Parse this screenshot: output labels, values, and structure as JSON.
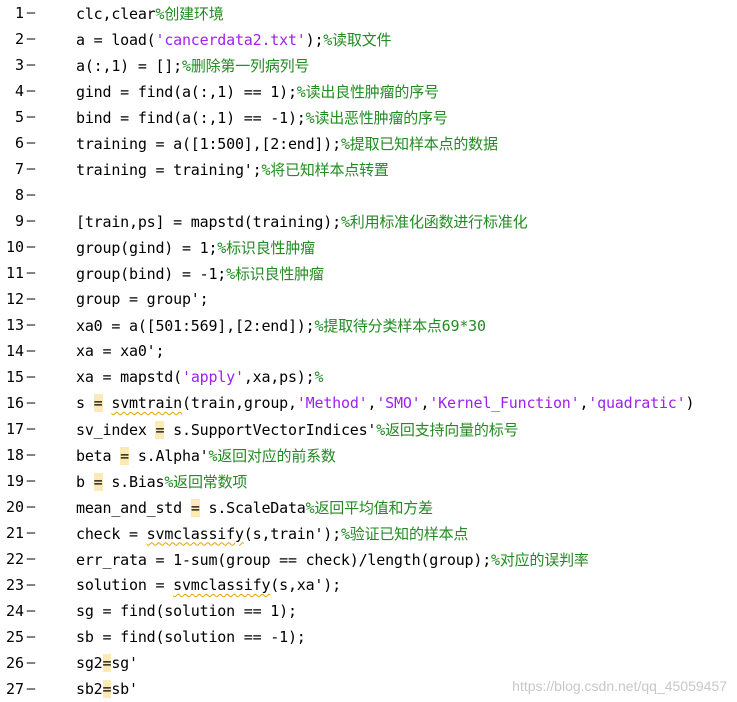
{
  "editor": {
    "lines": [
      {
        "num": "1",
        "parts": [
          {
            "t": "clc,clear"
          },
          {
            "t": "%创建环境",
            "c": "c"
          }
        ]
      },
      {
        "num": "2",
        "parts": [
          {
            "t": "a = load("
          },
          {
            "t": "'cancerdata2.txt'",
            "c": "s"
          },
          {
            "t": ");"
          },
          {
            "t": "%读取文件",
            "c": "c"
          }
        ]
      },
      {
        "num": "3",
        "parts": [
          {
            "t": "a(:,1) = [];"
          },
          {
            "t": "%删除第一列病列号",
            "c": "c"
          }
        ]
      },
      {
        "num": "4",
        "parts": [
          {
            "t": "gind = find(a(:,1) == 1);"
          },
          {
            "t": "%读出良性肿瘤的序号",
            "c": "c"
          }
        ]
      },
      {
        "num": "5",
        "parts": [
          {
            "t": "bind = find(a(:,1) == -1);"
          },
          {
            "t": "%读出恶性肿瘤的序号",
            "c": "c"
          }
        ]
      },
      {
        "num": "6",
        "parts": [
          {
            "t": "training = a([1:500],[2:end]);"
          },
          {
            "t": "%提取已知样本点的数据",
            "c": "c"
          }
        ]
      },
      {
        "num": "7",
        "parts": [
          {
            "t": "training = training';"
          },
          {
            "t": "%将已知样本点转置",
            "c": "c"
          }
        ]
      },
      {
        "num": "8",
        "parts": []
      },
      {
        "num": "9",
        "parts": [
          {
            "t": "[train,ps] = mapstd(training);"
          },
          {
            "t": "%利用标准化函数进行标准化",
            "c": "c"
          }
        ]
      },
      {
        "num": "10",
        "parts": [
          {
            "t": "group(gind) = 1;"
          },
          {
            "t": "%标识良性肿瘤",
            "c": "c"
          }
        ]
      },
      {
        "num": "11",
        "parts": [
          {
            "t": "group(bind) = -1;"
          },
          {
            "t": "%标识良性肿瘤",
            "c": "c"
          }
        ]
      },
      {
        "num": "12",
        "parts": [
          {
            "t": "group = group';"
          }
        ]
      },
      {
        "num": "13",
        "parts": [
          {
            "t": "xa0 = a([501:569],[2:end]);"
          },
          {
            "t": "%提取待分类样本点69*30",
            "c": "c"
          }
        ]
      },
      {
        "num": "14",
        "parts": [
          {
            "t": "xa = xa0';"
          }
        ]
      },
      {
        "num": "15",
        "parts": [
          {
            "t": "xa = mapstd("
          },
          {
            "t": "'apply'",
            "c": "s"
          },
          {
            "t": ",xa,ps);"
          },
          {
            "t": "%",
            "c": "c"
          }
        ]
      },
      {
        "num": "16",
        "parts": [
          {
            "t": "s "
          },
          {
            "t": "=",
            "c": "warn"
          },
          {
            "t": " "
          },
          {
            "t": "svmtrain",
            "c": "squiggle"
          },
          {
            "t": "(train,group,"
          },
          {
            "t": "'Method'",
            "c": "s"
          },
          {
            "t": ","
          },
          {
            "t": "'SMO'",
            "c": "s"
          },
          {
            "t": ","
          },
          {
            "t": "'Kernel_Function'",
            "c": "s"
          },
          {
            "t": ","
          },
          {
            "t": "'quadratic'",
            "c": "s"
          },
          {
            "t": ")"
          }
        ]
      },
      {
        "num": "17",
        "parts": [
          {
            "t": "sv_index "
          },
          {
            "t": "=",
            "c": "warn"
          },
          {
            "t": " s.SupportVectorIndices'"
          },
          {
            "t": "%返回支持向量的标号",
            "c": "c"
          }
        ]
      },
      {
        "num": "18",
        "parts": [
          {
            "t": "beta "
          },
          {
            "t": "=",
            "c": "warn"
          },
          {
            "t": " s.Alpha'"
          },
          {
            "t": "%返回对应的前系数",
            "c": "c"
          }
        ]
      },
      {
        "num": "19",
        "parts": [
          {
            "t": "b "
          },
          {
            "t": "=",
            "c": "warn"
          },
          {
            "t": " s.Bias"
          },
          {
            "t": "%返回常数项",
            "c": "c"
          }
        ]
      },
      {
        "num": "20",
        "parts": [
          {
            "t": "mean_and_std "
          },
          {
            "t": "=",
            "c": "warn"
          },
          {
            "t": " s.ScaleData"
          },
          {
            "t": "%返回平均值和方差",
            "c": "c"
          }
        ]
      },
      {
        "num": "21",
        "parts": [
          {
            "t": "check = "
          },
          {
            "t": "svmclassify",
            "c": "squiggle"
          },
          {
            "t": "(s,train');"
          },
          {
            "t": "%验证已知的样本点",
            "c": "c"
          }
        ]
      },
      {
        "num": "22",
        "parts": [
          {
            "t": "err_rata = 1-sum(group == check)/length(group);"
          },
          {
            "t": "%对应的误判率",
            "c": "c"
          }
        ]
      },
      {
        "num": "23",
        "parts": [
          {
            "t": "solution = "
          },
          {
            "t": "svmclassify",
            "c": "squiggle"
          },
          {
            "t": "(s,xa');"
          }
        ]
      },
      {
        "num": "24",
        "parts": [
          {
            "t": "sg = find(solution == 1);"
          }
        ]
      },
      {
        "num": "25",
        "parts": [
          {
            "t": "sb = find(solution == -1);"
          }
        ]
      },
      {
        "num": "26",
        "parts": [
          {
            "t": "sg2"
          },
          {
            "t": "=",
            "c": "warn"
          },
          {
            "t": "sg'"
          }
        ]
      },
      {
        "num": "27",
        "parts": [
          {
            "t": "sb2"
          },
          {
            "t": "=",
            "c": "warn"
          },
          {
            "t": "sb'"
          }
        ]
      }
    ],
    "dash_char": "—"
  },
  "watermark": "https://blog.csdn.net/qq_45059457"
}
